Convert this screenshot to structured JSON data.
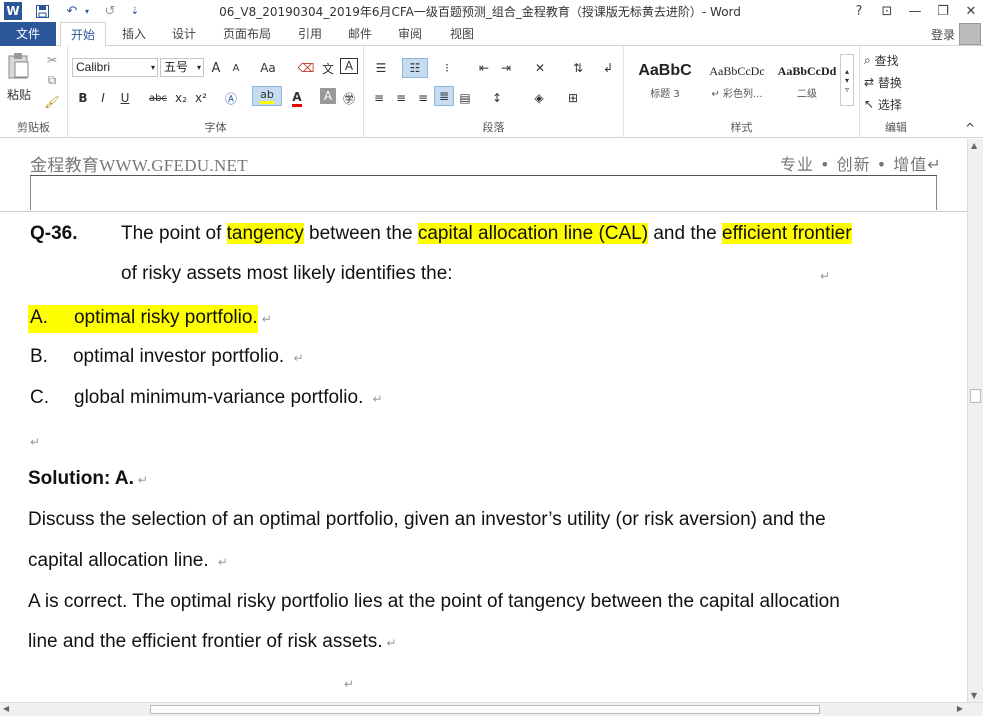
{
  "window": {
    "title": "06_V8_20190304_2019年6月CFA一级百题预测_组合_金程教育（授课版无标黄去进阶）- Word",
    "help": "?",
    "restore_ribbon": "⊡",
    "minimize": "—",
    "maximize": "❐",
    "close": "✕"
  },
  "quick_access": {
    "save_icon": "💾",
    "undo_icon": "↶",
    "redo_icon": "↺",
    "more_icon": "⇣"
  },
  "tabs": [
    "文件",
    "开始",
    "插入",
    "设计",
    "页面布局",
    "引用",
    "邮件",
    "审阅",
    "视图"
  ],
  "account": {
    "login": "登录"
  },
  "ribbon": {
    "clipboard": {
      "paste": "粘贴",
      "label": "剪贴板"
    },
    "font": {
      "name": "Calibri",
      "size": "五号",
      "grow": "A",
      "shrink": "A",
      "case": "Aa",
      "bold": "B",
      "italic": "I",
      "underline": "U",
      "strike": "abc",
      "sub": "x₂",
      "sup": "x²",
      "label": "字体"
    },
    "paragraph": {
      "label": "段落"
    },
    "styles": {
      "items": [
        {
          "preview": "AaBbC",
          "name": "标题 3"
        },
        {
          "preview": "AaBbCcDc",
          "name": "↵ 彩色列..."
        },
        {
          "preview": "AaBbCcDd",
          "name": "二级"
        }
      ],
      "label": "样式"
    },
    "editing": {
      "find": "查找",
      "replace": "替换",
      "select": "选择",
      "label": "编辑"
    },
    "collapse": "^"
  },
  "document": {
    "header_left": "金程教育WWW.GFEDU.NET",
    "header_right": "专业 • 创新 • 增值↵",
    "question": {
      "number": "Q-36.",
      "text_1": "The point of ",
      "hl_1": "tangency",
      "text_2": " between the ",
      "hl_2": "capital allocation line (CAL)",
      "text_3": " and the ",
      "hl_3": "efficient frontier",
      "line_2": "of risky assets most likely identifies the:"
    },
    "options": [
      {
        "letter": "A.",
        "text": "optimal risky portfolio. "
      },
      {
        "letter": "B.",
        "text": "optimal investor portfolio. "
      },
      {
        "letter": "C.",
        "text": "global minimum-variance portfolio. "
      }
    ],
    "solution_title": "Solution: A.",
    "discuss_1": "Discuss the selection of an optimal portfolio, given an investor’s utility (or risk aversion) and the",
    "discuss_2": "capital allocation line. ",
    "correct_1": "A is correct. The optimal risky portfolio lies at the point of tangency between the capital allocation",
    "correct_2": "line and the efficient frontier of risk assets.",
    "para_mark": "↵"
  }
}
